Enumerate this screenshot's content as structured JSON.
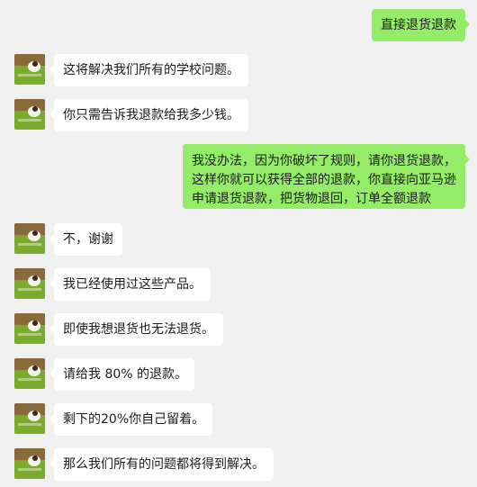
{
  "colors": {
    "background": "#f0f0f0",
    "incoming_bubble": "#ffffff",
    "outgoing_bubble": "#95ec69"
  },
  "messages": [
    {
      "side": "out",
      "text": "直接退货退款"
    },
    {
      "side": "in",
      "text": "这将解决我们所有的学校问题。"
    },
    {
      "side": "in",
      "text": "你只需告诉我退款给我多少钱。"
    },
    {
      "side": "out",
      "lines": [
        "我没办法，因为你破坏了规则，请你退货退款，",
        "这样你就可以获得全部的退款，你直接向亚马逊",
        "申请退货退款，把货物退回，订单全额退款"
      ]
    },
    {
      "side": "in",
      "text": "不，谢谢"
    },
    {
      "side": "in",
      "text": "我已经使用过这些产品。"
    },
    {
      "side": "in",
      "text": "即使我想退货也无法退货。"
    },
    {
      "side": "in",
      "text": "请给我 80% 的退款。"
    },
    {
      "side": "in",
      "text": "剩下的20%你自己留着。"
    },
    {
      "side": "in",
      "text": "那么我们所有的问题都将得到解决。"
    }
  ]
}
